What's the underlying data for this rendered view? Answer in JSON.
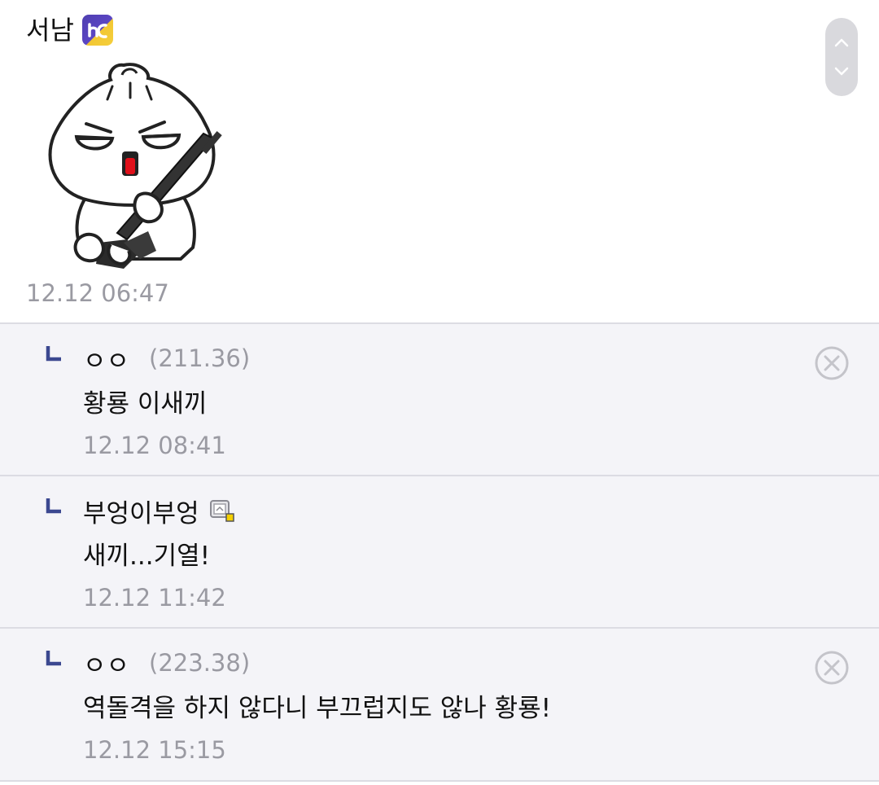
{
  "main": {
    "author": "서남",
    "time": "12.12 06:47"
  },
  "replies": [
    {
      "name": "ㅇㅇ",
      "ip": "(211.36)",
      "text": "황룡 이새끼",
      "time": "12.12 08:41",
      "deletable": true
    },
    {
      "name": "부엉이부엉",
      "ip": "",
      "text": "새끼...기열!",
      "time": "12.12 11:42",
      "deletable": false
    },
    {
      "name": "ㅇㅇ",
      "ip": "(223.38)",
      "text": "역돌격을 하지 않다니 부끄럽지도 않나 황룡!",
      "time": "12.12 15:15",
      "deletable": true
    }
  ],
  "icons": {
    "badge": "gallog-badge-icon",
    "scroll_up": "chevron-up-icon",
    "scroll_down": "chevron-down-icon",
    "reply": "reply-arrow-icon",
    "delete": "close-circle-icon",
    "fixed_user": "fixed-nick-icon"
  },
  "colors": {
    "reply_bg": "#f4f4f8",
    "reply_arrow": "#3b4890",
    "meta_gray": "#9a9aa2",
    "badge_purple": "#5b46c4",
    "badge_yellow": "#f2c733"
  }
}
